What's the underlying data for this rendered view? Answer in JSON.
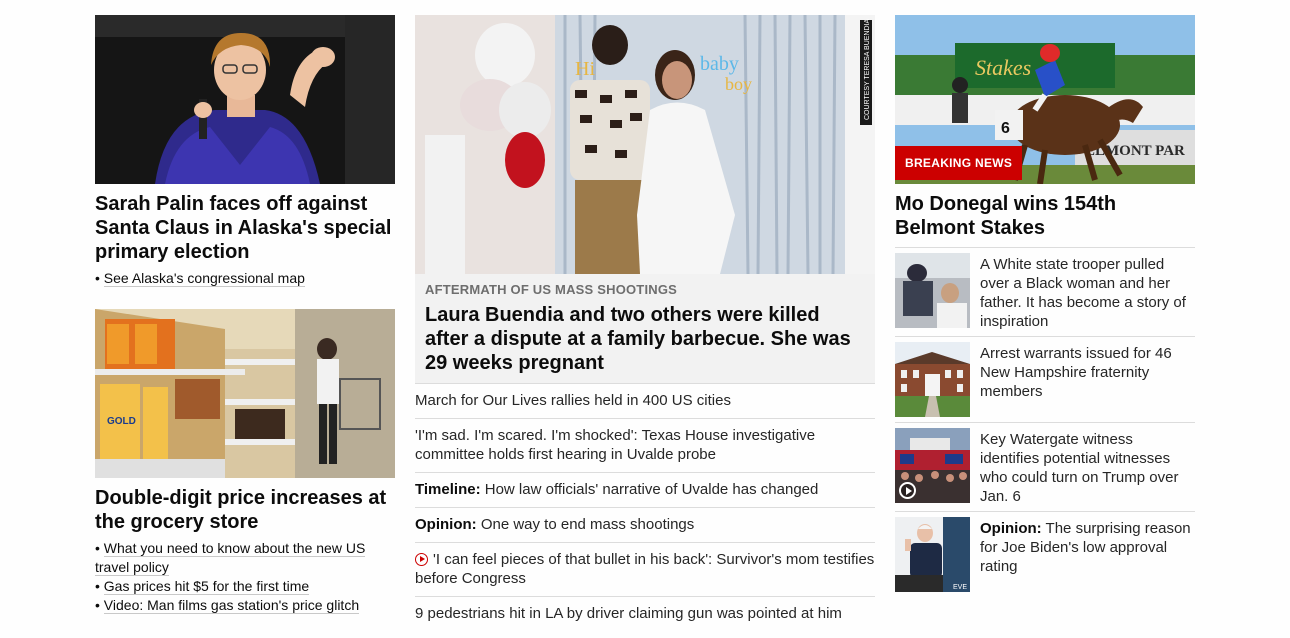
{
  "left": {
    "story1": {
      "headline": "Sarah Palin faces off against Santa Claus in Alaska's special primary election",
      "links": [
        "See Alaska's congressional map"
      ]
    },
    "story2": {
      "headline": "Double-digit price increases at the grocery store",
      "links": [
        "What you need to know about the new US travel policy",
        "Gas prices hit $5 for the first time",
        "Video: Man films gas station's price glitch"
      ]
    }
  },
  "middle": {
    "credit": "COURTESY TERESA BUENDIA",
    "section_label": "AFTERMATH OF US MASS SHOOTINGS",
    "headline": "Laura Buendia and two others were killed after a dispute at a family barbecue. She was 29 weeks pregnant",
    "items": [
      {
        "prefix": "",
        "text": "March for Our Lives rallies held in 400 US cities"
      },
      {
        "prefix": "",
        "text": "'I'm sad. I'm scared. I'm shocked': Texas House investigative committee holds first hearing in Uvalde probe"
      },
      {
        "prefix": "Timeline:",
        "text": " How law officials' narrative of Uvalde has changed"
      },
      {
        "prefix": "Opinion:",
        "text": " One way to end mass shootings"
      },
      {
        "prefix": "",
        "text": "'I can feel pieces of that bullet in his back': Survivor's mom testifies before Congress",
        "icon": "play-circle-icon"
      },
      {
        "prefix": "",
        "text": "9 pedestrians hit in LA by driver claiming gun was pointed at him"
      }
    ]
  },
  "right": {
    "badge": "BREAKING NEWS",
    "headline": "Mo Donegal wins 154th Belmont Stakes",
    "items": [
      {
        "prefix": "",
        "text": "A White state trooper pulled over a Black woman and her father. It has become a story of inspiration"
      },
      {
        "prefix": "",
        "text": "Arrest warrants issued for 46 New Hampshire fraternity members"
      },
      {
        "prefix": "",
        "text": "Key Watergate witness identifies potential witnesses who could turn on Trump over Jan. 6",
        "icon": "play-circle-icon"
      },
      {
        "prefix": "Opinion:",
        "text": " The surprising reason for Joe Biden's low approval rating"
      }
    ]
  },
  "colors": {
    "breaking_red": "#cc0000",
    "text": "#0c0c0c",
    "divider": "#dcdcdc"
  }
}
